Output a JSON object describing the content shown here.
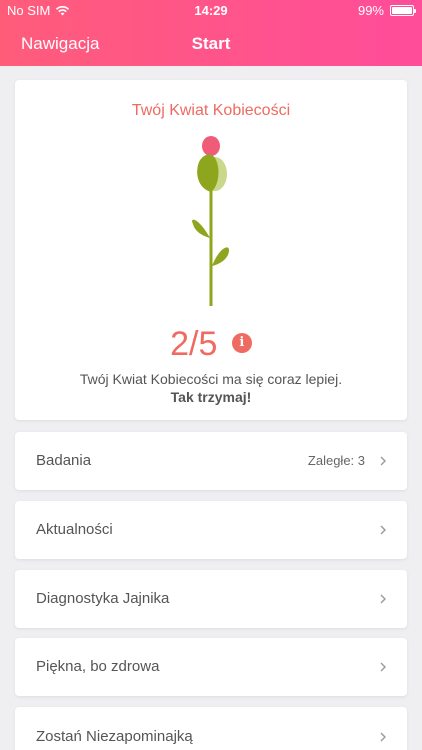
{
  "status_bar": {
    "carrier": "No SIM",
    "time": "14:29",
    "battery_percent": "99%",
    "battery_level": 0.99
  },
  "nav": {
    "left_label": "Nawigacja",
    "title": "Start"
  },
  "flower": {
    "title": "Twój Kwiat Kobiecości",
    "score": "2/5",
    "info_icon": "i",
    "description": "Twój Kwiat Kobiecości ma się coraz lepiej.",
    "emphasis": "Tak trzymaj!"
  },
  "rows": [
    {
      "label": "Badania",
      "meta": "Zaległe: 3"
    },
    {
      "label": "Aktualności",
      "meta": ""
    },
    {
      "label": "Diagnostyka Jajnika",
      "meta": ""
    },
    {
      "label": "Piękna, bo zdrowa",
      "meta": ""
    },
    {
      "label": "Zostań Niezapominajką",
      "meta": ""
    }
  ],
  "colors": {
    "header_gradient_start": "#ff5c7a",
    "header_gradient_end": "#ff4d9a",
    "accent": "#ef6a61",
    "flower_petal": "#f05c78",
    "leaf": "#8ea51e",
    "background": "#efeff2"
  },
  "icons": {
    "wifi": "wifi-icon",
    "battery": "battery-icon",
    "info": "info-icon",
    "chevron": "chevron-right-icon",
    "flower": "flower-illustration"
  }
}
